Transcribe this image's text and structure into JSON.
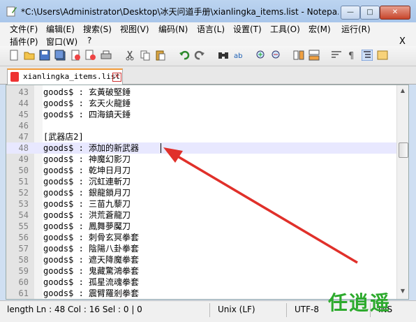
{
  "window": {
    "title": "*C:\\Users\\Administrator\\Desktop\\冰天问道手册\\xianlingka_items.list - Notepa...",
    "min_glyph": "—",
    "max_glyph": "□",
    "close_glyph": "✕"
  },
  "menu": {
    "row1": [
      "文件(F)",
      "编辑(E)",
      "搜索(S)",
      "视图(V)",
      "编码(N)",
      "语言(L)",
      "设置(T)",
      "工具(O)",
      "宏(M)",
      "运行(R)"
    ],
    "row2": [
      "插件(P)",
      "窗口(W)",
      "?"
    ],
    "close": "X"
  },
  "tab": {
    "label": "xianlingka_items.list",
    "close": "✕"
  },
  "editor": {
    "lines": [
      {
        "num": "43",
        "text": "goods$ : 玄黃破堅錘"
      },
      {
        "num": "44",
        "text": "goods$ : 玄天火龍錘"
      },
      {
        "num": "45",
        "text": "goods$ : 四海鎮天錘"
      },
      {
        "num": "46",
        "text": ""
      },
      {
        "num": "47",
        "text": "[武器店2]"
      },
      {
        "num": "48",
        "text": "goods$ : 添加的新武器"
      },
      {
        "num": "49",
        "text": "goods$ : 神魔幻影刀"
      },
      {
        "num": "50",
        "text": "goods$ : 乾坤日月刀"
      },
      {
        "num": "51",
        "text": "goods$ : 沉虹連斬刀"
      },
      {
        "num": "52",
        "text": "goods$ : 銀龍鎖月刀"
      },
      {
        "num": "53",
        "text": "goods$ : 三苗九藜刀"
      },
      {
        "num": "54",
        "text": "goods$ : 洪荒蒼龍刀"
      },
      {
        "num": "55",
        "text": "goods$ : 鳳舞夢魘刀"
      },
      {
        "num": "56",
        "text": "goods$ : 刺骨玄冥拳套"
      },
      {
        "num": "57",
        "text": "goods$ : 陰陽八卦拳套"
      },
      {
        "num": "58",
        "text": "goods$ : 遮天降魔拳套"
      },
      {
        "num": "59",
        "text": "goods$ : 鬼藏驚鴻拳套"
      },
      {
        "num": "60",
        "text": "goods$ : 孤星流魂拳套"
      },
      {
        "num": "61",
        "text": "goods$ : 震臂羅剎拳套"
      }
    ],
    "current_line_index": 5
  },
  "status": {
    "length": "length",
    "position": "Ln : 48    Col : 16    Sel : 0 | 0",
    "eol": "Unix (LF)",
    "encoding": "UTF-8",
    "mode": "INS"
  },
  "watermark": "任逍遥",
  "colors": {
    "annotation_arrow": "#e0302a",
    "current_line": "#e8e8ff",
    "watermark": "#2daa2d"
  }
}
